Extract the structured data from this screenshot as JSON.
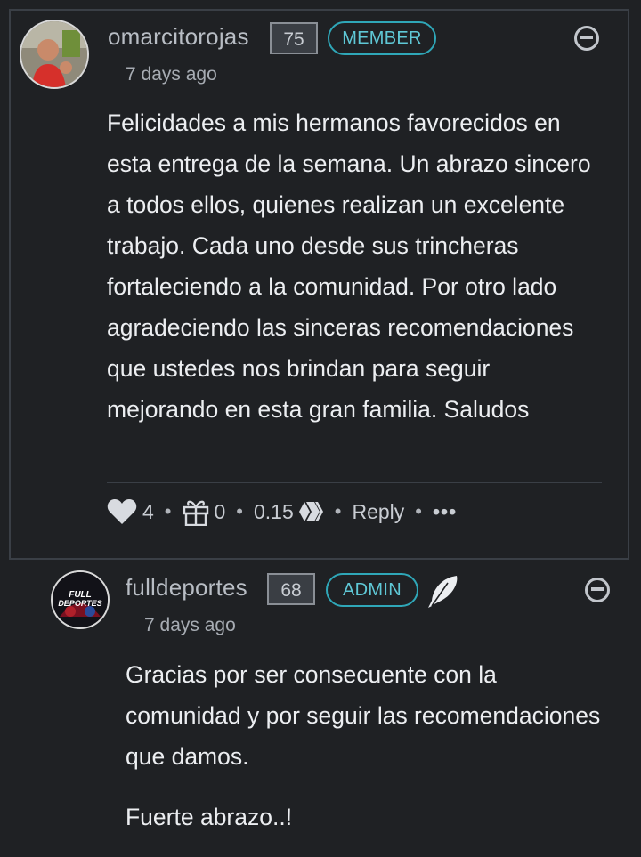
{
  "comment": {
    "username": "omarcitorojas",
    "reputation": "75",
    "role_badge": "MEMBER",
    "timestamp": "7 days ago",
    "body": "Felicidades a mis hermanos favorecidos en esta entrega de la semana. Un abrazo sincero a todos ellos, quienes realizan un excelente trabajo. Cada uno desde sus trincheras fortaleciendo a la comunidad. Por otro lado agradeciendo las sinceras recomendaciones que ustedes nos brindan para seguir mejorando en esta gran familia. Saludos",
    "votes_count": "4",
    "gifts_count": "0",
    "payout": "0.15",
    "reply_label": "Reply",
    "more_label": "•••",
    "separator": "•"
  },
  "reply": {
    "username": "fulldeportes",
    "reputation": "68",
    "role_badge": "ADMIN",
    "timestamp": "7 days ago",
    "avatar_text": "FULL DEPORTES",
    "paragraphs": [
      "Gracias por ser consecuente con la comunidad y por seguir las recomendaciones que damos.",
      "Fuerte abrazo..!"
    ]
  },
  "colors": {
    "background": "#1f2124",
    "badge_accent": "#2fa7b8",
    "text": "#eceef1",
    "muted": "#a7acb3"
  },
  "icons": [
    "heart-icon",
    "gift-icon",
    "hive-icon",
    "collapse-icon",
    "feather-icon"
  ]
}
